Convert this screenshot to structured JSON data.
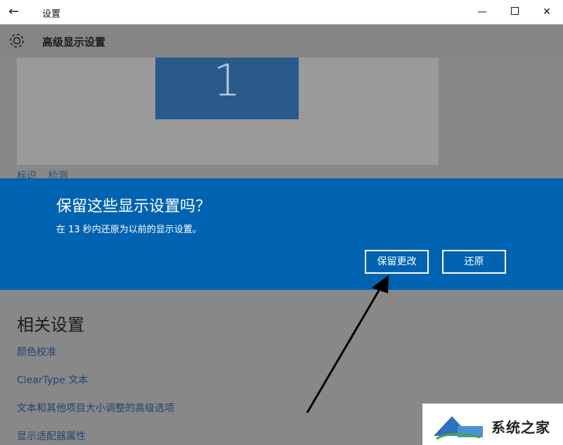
{
  "window": {
    "back_icon": "back-arrow-icon",
    "title": "设置",
    "controls": {
      "minimize": "—",
      "maximize": "□",
      "close": "✕"
    }
  },
  "header": {
    "icon": "gear-icon",
    "title": "高级显示设置"
  },
  "display_preview": {
    "monitor_number": "1",
    "links": [
      "标识",
      "检测"
    ]
  },
  "dialog": {
    "title": "保留这些显示设置吗？",
    "message": "在 13 秒内还原为以前的显示设置。",
    "keep_button": "保留更改",
    "revert_button": "还原",
    "background": "#0063b1"
  },
  "related": {
    "heading": "相关设置",
    "links": [
      "颜色校准",
      "ClearType 文本",
      "文本和其他项目大小调整的高级选项",
      "显示适配器属性"
    ]
  },
  "watermark": {
    "text": "系统之家"
  }
}
